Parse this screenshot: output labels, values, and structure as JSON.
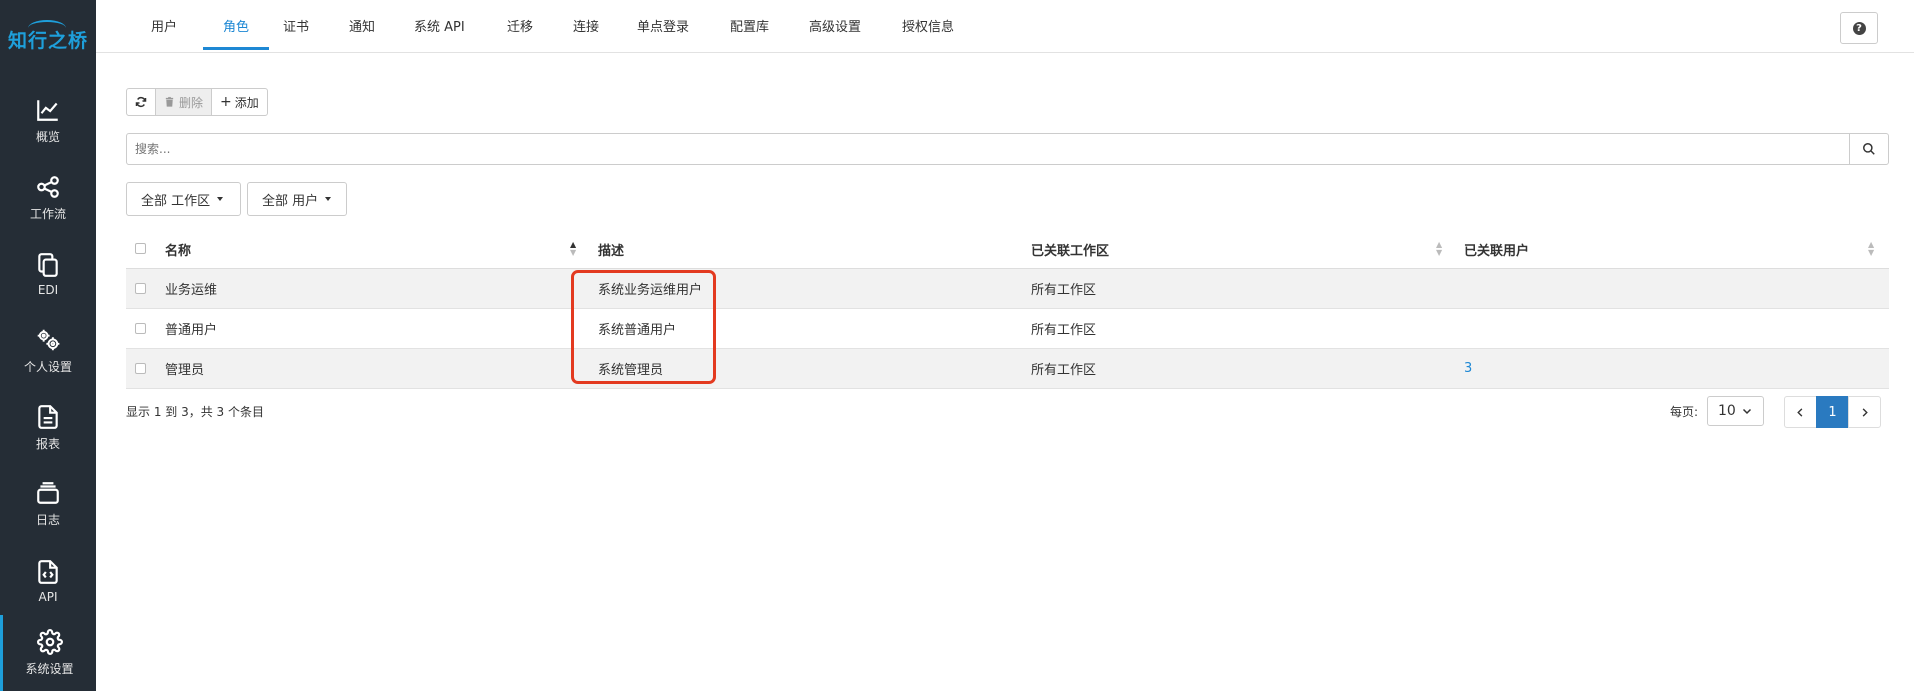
{
  "app": {
    "logo": "知行之桥",
    "brand_color": "#1e9fdb"
  },
  "sidebar": {
    "items": [
      {
        "label": "概览",
        "icon": "chart-line-icon"
      },
      {
        "label": "工作流",
        "icon": "share-nodes-icon"
      },
      {
        "label": "EDI",
        "icon": "copy-files-icon"
      },
      {
        "label": "个人设置",
        "icon": "cogs-icon"
      },
      {
        "label": "报表",
        "icon": "file-report-icon"
      },
      {
        "label": "日志",
        "icon": "log-stack-icon"
      },
      {
        "label": "API",
        "icon": "file-code-icon"
      },
      {
        "label": "系统设置",
        "icon": "gear-icon",
        "active": true
      }
    ]
  },
  "tabs": [
    {
      "label": "用户"
    },
    {
      "label": "角色",
      "active": true
    },
    {
      "label": "证书"
    },
    {
      "label": "通知"
    },
    {
      "label": "系统 API"
    },
    {
      "label": "迁移"
    },
    {
      "label": "连接"
    },
    {
      "label": "单点登录"
    },
    {
      "label": "配置库"
    },
    {
      "label": "高级设置"
    },
    {
      "label": "授权信息"
    }
  ],
  "help": {
    "label": "?"
  },
  "toolbar": {
    "delete_label": "删除",
    "add_label": "添加"
  },
  "search": {
    "placeholder": "搜索..."
  },
  "filters": {
    "workspace": "全部 工作区",
    "user": "全部 用户"
  },
  "table": {
    "columns": [
      "名称",
      "描述",
      "已关联工作区",
      "已关联用户"
    ],
    "rows": [
      {
        "name": "业务运维",
        "desc": "系统业务运维用户",
        "workspace": "所有工作区",
        "users": ""
      },
      {
        "name": "普通用户",
        "desc": "系统普通用户",
        "workspace": "所有工作区",
        "users": ""
      },
      {
        "name": "管理员",
        "desc": "系统管理员",
        "workspace": "所有工作区",
        "users": "3"
      }
    ]
  },
  "footer": {
    "info": "显示 1 到 3，共 3 个条目",
    "per_page_label": "每页:",
    "per_page": "10",
    "current_page": "1"
  }
}
